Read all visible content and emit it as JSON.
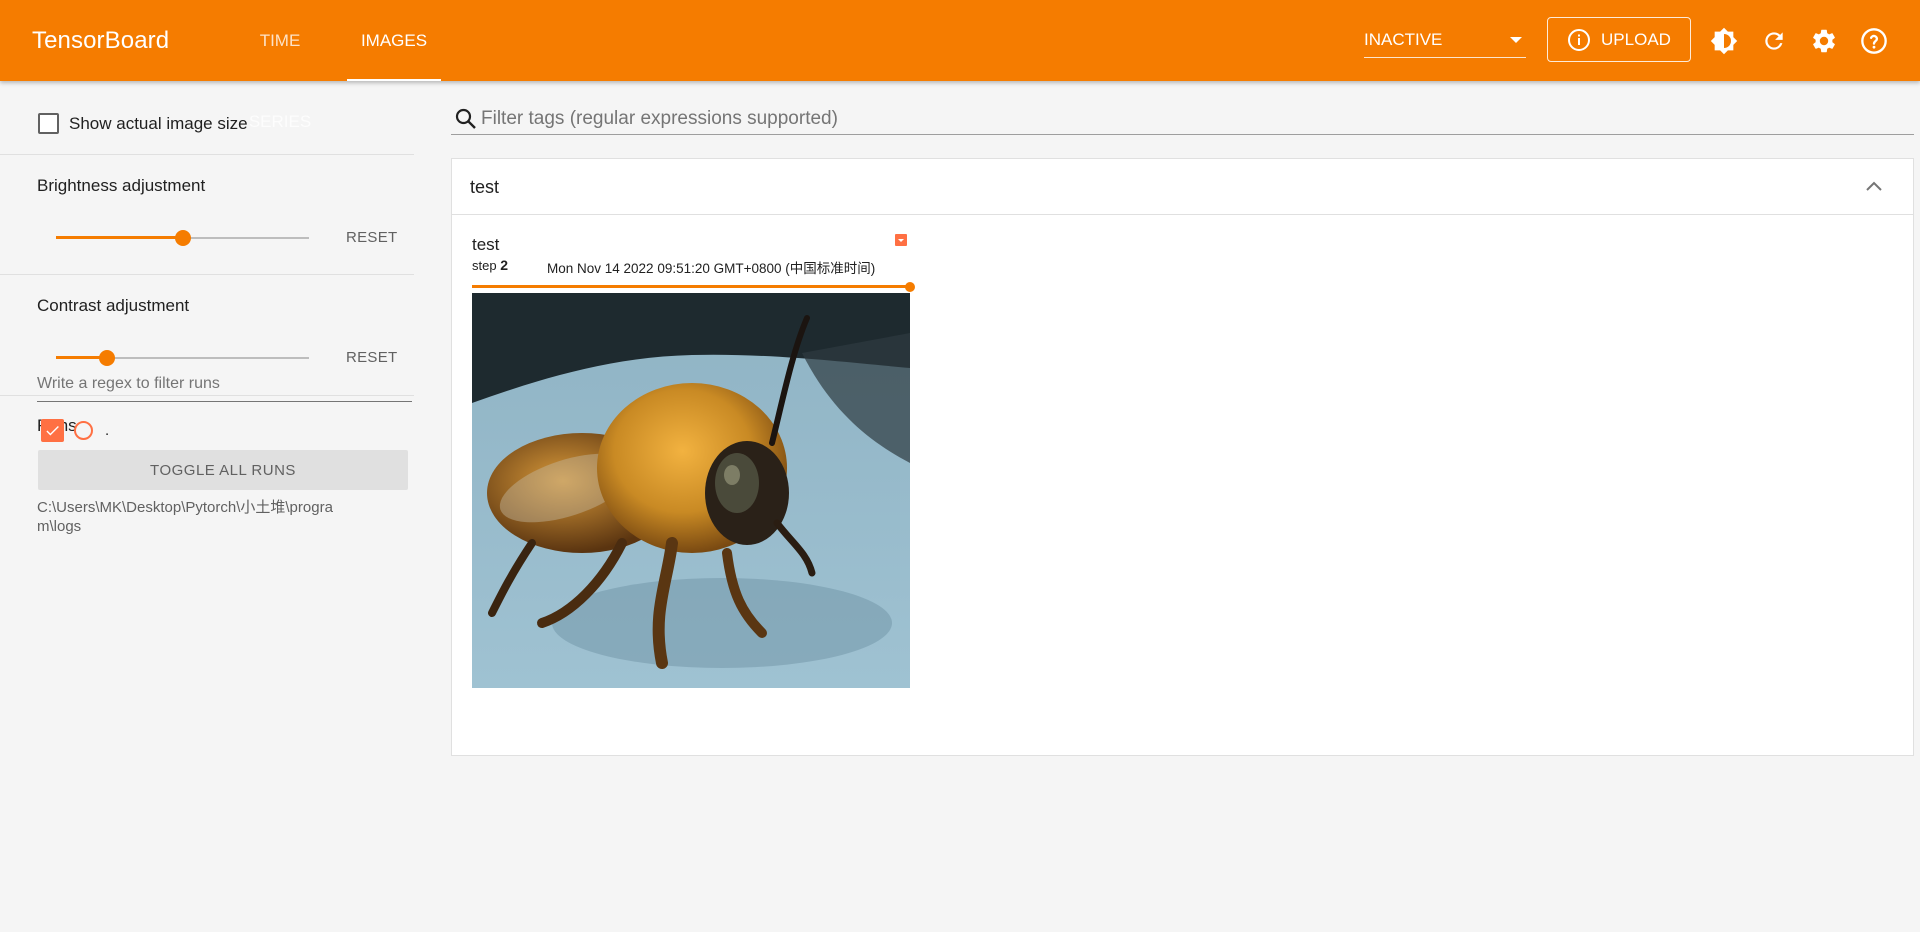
{
  "header": {
    "brand": "TensorBoard",
    "tabs": [
      {
        "label": "TIME SERIES",
        "active": false
      },
      {
        "label": "IMAGES",
        "active": true
      }
    ],
    "reload_select": "INACTIVE",
    "upload_label": "UPLOAD",
    "icons": [
      "brightness-icon",
      "refresh-icon",
      "settings-icon",
      "help-icon"
    ],
    "accent_color": "#f57c00"
  },
  "sidebar": {
    "actual_size_label": "Show actual image size",
    "actual_size_checked": false,
    "brightness": {
      "label": "Brightness adjustment",
      "value": 0.5,
      "reset_label": "RESET"
    },
    "contrast": {
      "label": "Contrast adjustment",
      "value": 0.2,
      "reset_label": "RESET"
    },
    "runs": {
      "title": "Runs",
      "filter_placeholder": "Write a regex to filter runs",
      "items": [
        {
          "name": ".",
          "checked": true,
          "color": "#ff7043"
        }
      ],
      "toggle_label": "TOGGLE ALL RUNS",
      "logdir": "C:\\Users\\MK\\Desktop\\Pytorch\\小土堆\\program\\logs"
    }
  },
  "main": {
    "filter_placeholder": "Filter tags (regular expressions supported)",
    "group": {
      "title": "test",
      "expanded": true,
      "image_card": {
        "title": "test",
        "step_prefix": "step",
        "step": "2",
        "timestamp": "Mon Nov 14 2022 09:51:20 GMT+0800 (中国标准时间)",
        "step_slider_value": 1.0,
        "image_alt": "bee"
      }
    }
  }
}
